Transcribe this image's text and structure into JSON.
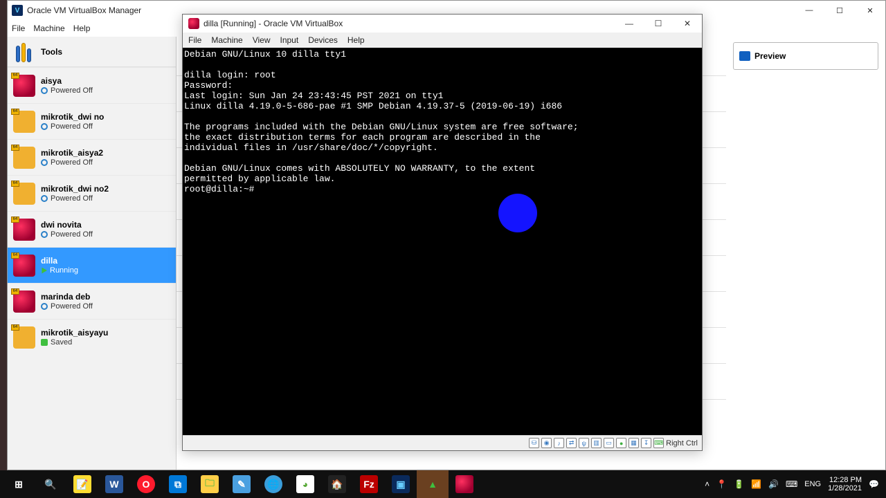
{
  "manager": {
    "title": "Oracle VM VirtualBox Manager",
    "menu": {
      "file": "File",
      "machine": "Machine",
      "help": "Help"
    },
    "tools_label": "Tools",
    "preview_label": "Preview",
    "vms": [
      {
        "name": "aisya",
        "status": "Powered Off",
        "kind": "deb",
        "state": "off"
      },
      {
        "name": "mikrotik_dwi no",
        "status": "Powered Off",
        "kind": "other",
        "state": "off"
      },
      {
        "name": "mikrotik_aisya2",
        "status": "Powered Off",
        "kind": "other",
        "state": "off"
      },
      {
        "name": "mikrotik_dwi no2",
        "status": "Powered Off",
        "kind": "other",
        "state": "off"
      },
      {
        "name": "dwi novita",
        "status": "Powered Off",
        "kind": "deb",
        "state": "off"
      },
      {
        "name": "dilla",
        "status": "Running",
        "kind": "deb",
        "state": "run",
        "selected": true
      },
      {
        "name": "marinda deb",
        "status": "Powered Off",
        "kind": "deb",
        "state": "off"
      },
      {
        "name": "mikrotik_aisyayu",
        "status": "Saved",
        "kind": "other",
        "state": "saved"
      }
    ]
  },
  "vm_win": {
    "title": "dilla  [Running] - Oracle VM VirtualBox",
    "menu": {
      "file": "File",
      "machine": "Machine",
      "view": "View",
      "input": "Input",
      "devices": "Devices",
      "help": "Help"
    },
    "hostkey": "Right Ctrl",
    "console_text": "Debian GNU/Linux 10 dilla tty1\n\ndilla login: root\nPassword:\nLast login: Sun Jan 24 23:43:45 PST 2021 on tty1\nLinux dilla 4.19.0-5-686-pae #1 SMP Debian 4.19.37-5 (2019-06-19) i686\n\nThe programs included with the Debian GNU/Linux system are free software;\nthe exact distribution terms for each program are described in the\nindividual files in /usr/share/doc/*/copyright.\n\nDebian GNU/Linux comes with ABSOLUTELY NO WARRANTY, to the extent\npermitted by applicable law.\nroot@dilla:~# "
  },
  "system_tray": {
    "lang": "ENG",
    "time": "12:28 PM",
    "date": "1/28/2021"
  }
}
